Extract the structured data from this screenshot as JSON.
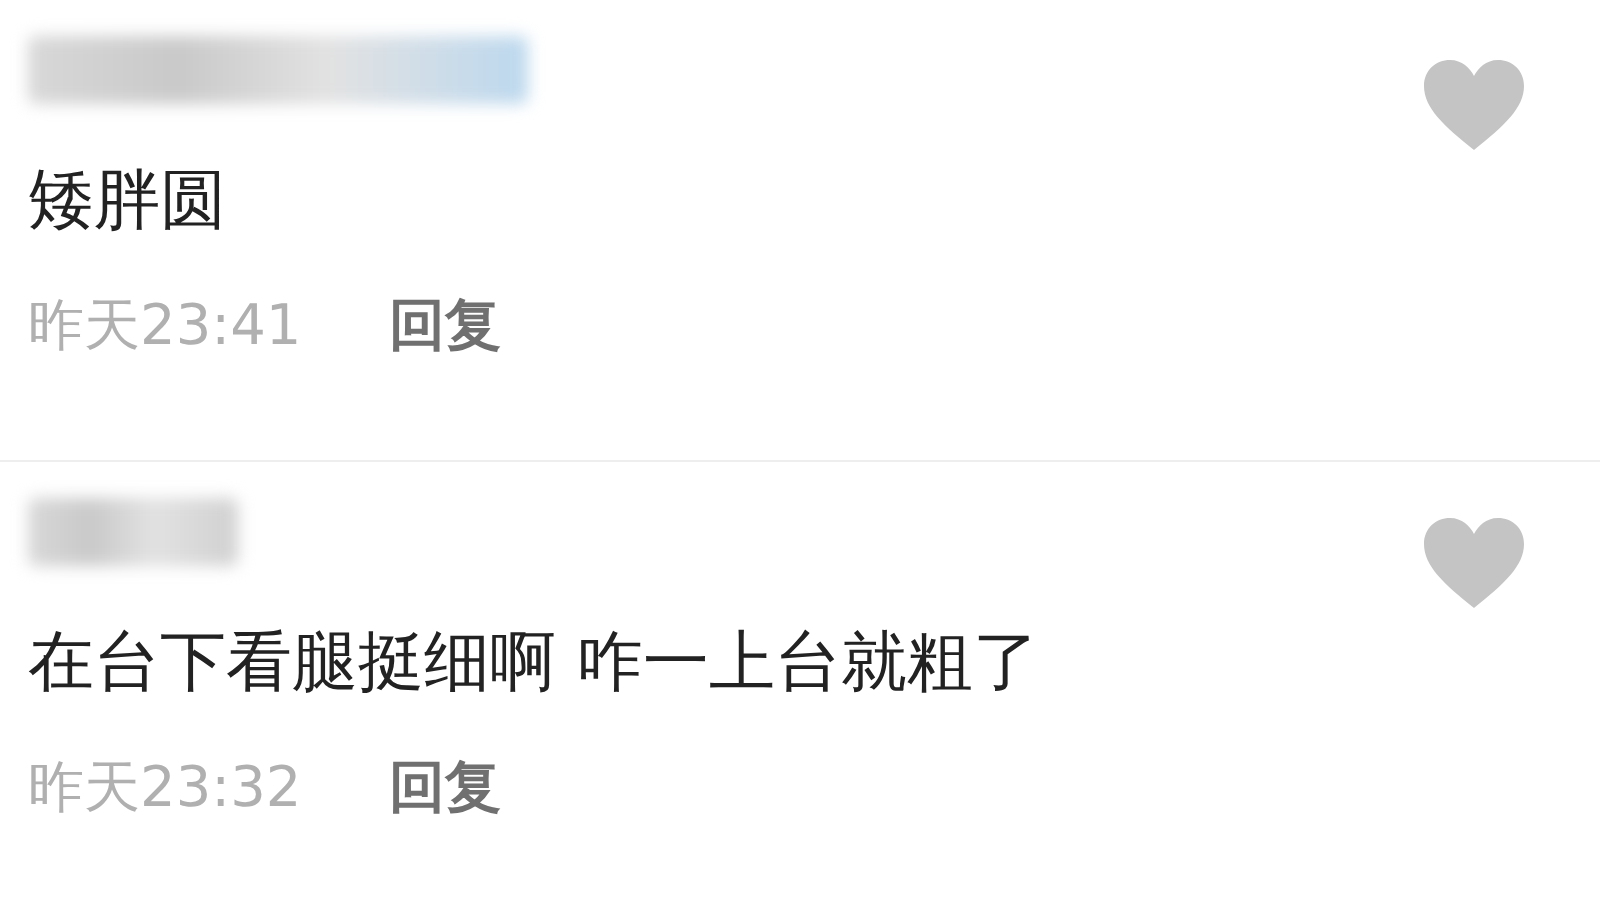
{
  "comments": [
    {
      "text": "矮胖圆",
      "time": "昨天23:41",
      "reply": "回复",
      "liked": false
    },
    {
      "text": "在台下看腿挺细啊 咋一上台就粗了",
      "time": "昨天23:32",
      "reply": "回复",
      "liked": false
    }
  ]
}
